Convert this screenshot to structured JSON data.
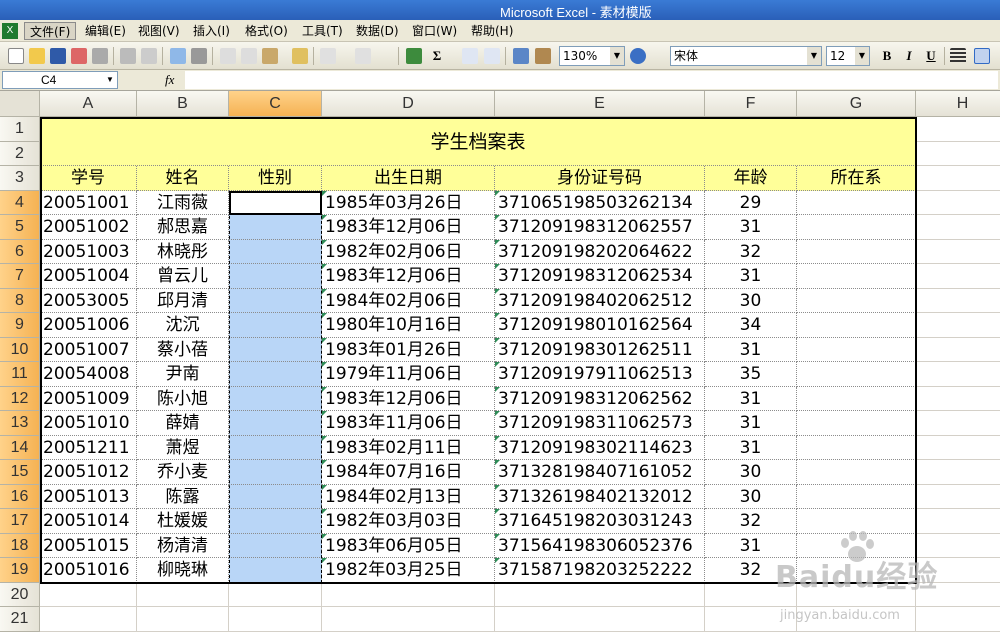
{
  "window": {
    "title": "Microsoft Excel - 素材模版"
  },
  "menu": {
    "items": [
      "文件(F)",
      "编辑(E)",
      "视图(V)",
      "插入(I)",
      "格式(O)",
      "工具(T)",
      "数据(D)",
      "窗口(W)",
      "帮助(H)"
    ],
    "active_index": 0
  },
  "toolbar": {
    "zoom": "130%",
    "font_name": "宋体",
    "font_size": "12",
    "bold_label": "B",
    "italic_label": "I",
    "underline_label": "U"
  },
  "formula_bar": {
    "name_box": "C4",
    "fx_label": "fx",
    "formula": ""
  },
  "columns": [
    "A",
    "B",
    "C",
    "D",
    "E",
    "F",
    "G",
    "H"
  ],
  "selected_column": "C",
  "rows": [
    "1",
    "2",
    "3",
    "4",
    "5",
    "6",
    "7",
    "8",
    "9",
    "10",
    "11",
    "12",
    "13",
    "14",
    "15",
    "16",
    "17",
    "18",
    "19",
    "20",
    "21"
  ],
  "sheet": {
    "title": "学生档案表",
    "headers": [
      "学号",
      "姓名",
      "性别",
      "出生日期",
      "身份证号码",
      "年龄",
      "所在系"
    ],
    "records": [
      [
        "20051001",
        "江雨薇",
        "",
        "1985年03月26日",
        "371065198503262134",
        "29",
        ""
      ],
      [
        "20051002",
        "郝思嘉",
        "",
        "1983年12月06日",
        "371209198312062557",
        "31",
        ""
      ],
      [
        "20051003",
        "林晓彤",
        "",
        "1982年02月06日",
        "371209198202064622",
        "32",
        ""
      ],
      [
        "20051004",
        "曾云儿",
        "",
        "1983年12月06日",
        "371209198312062534",
        "31",
        ""
      ],
      [
        "20053005",
        "邱月清",
        "",
        "1984年02月06日",
        "371209198402062512",
        "30",
        ""
      ],
      [
        "20051006",
        "沈沉",
        "",
        "1980年10月16日",
        "371209198010162564",
        "34",
        ""
      ],
      [
        "20051007",
        "蔡小蓓",
        "",
        "1983年01月26日",
        "371209198301262511",
        "31",
        ""
      ],
      [
        "20054008",
        "尹南",
        "",
        "1979年11月06日",
        "371209197911062513",
        "35",
        ""
      ],
      [
        "20051009",
        "陈小旭",
        "",
        "1983年12月06日",
        "371209198312062562",
        "31",
        ""
      ],
      [
        "20051010",
        "薛婧",
        "",
        "1983年11月06日",
        "371209198311062573",
        "31",
        ""
      ],
      [
        "20051211",
        "萧煜",
        "",
        "1983年02月11日",
        "371209198302114623",
        "31",
        ""
      ],
      [
        "20051012",
        "乔小麦",
        "",
        "1984年07月16日",
        "371328198407161052",
        "30",
        ""
      ],
      [
        "20051013",
        "陈露",
        "",
        "1984年02月13日",
        "371326198402132012",
        "30",
        ""
      ],
      [
        "20051014",
        "杜媛媛",
        "",
        "1982年03月03日",
        "371645198203031243",
        "32",
        ""
      ],
      [
        "20051015",
        "杨清清",
        "",
        "1983年06月05日",
        "371564198306052376",
        "31",
        ""
      ],
      [
        "20051016",
        "柳晓琳",
        "",
        "1982年03月25日",
        "371587198203252222",
        "32",
        ""
      ]
    ]
  },
  "watermark": {
    "brand": "Baidu经验",
    "url": "jingyan.baidu.com"
  },
  "colors": {
    "header_fill": "#ffff99",
    "selection_fill": "#b9d6f7",
    "titlebar": "#2a5fb8"
  }
}
